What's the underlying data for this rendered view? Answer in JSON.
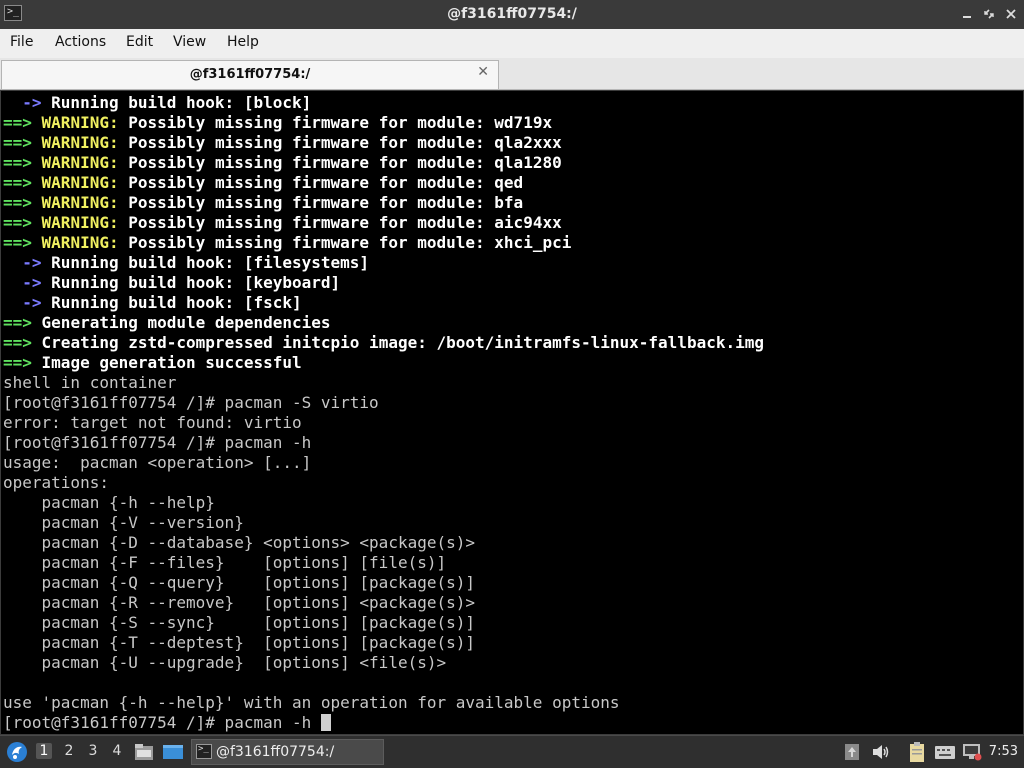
{
  "window": {
    "title": "@f3161ff07754:/",
    "icon": "terminal-icon"
  },
  "menubar": {
    "items": [
      "File",
      "Actions",
      "Edit",
      "View",
      "Help"
    ]
  },
  "tab": {
    "label": "@f3161ff07754:/"
  },
  "terminal": {
    "lines": [
      [
        {
          "t": "  ",
          "c": ""
        },
        {
          "t": "->",
          "c": "bl"
        },
        {
          "t": " Running build hook: [block]",
          "c": "b"
        }
      ],
      [
        {
          "t": "==>",
          "c": "g"
        },
        {
          "t": " WARNING:",
          "c": "y"
        },
        {
          "t": " Possibly missing firmware for module: wd719x",
          "c": "b"
        }
      ],
      [
        {
          "t": "==>",
          "c": "g"
        },
        {
          "t": " WARNING:",
          "c": "y"
        },
        {
          "t": " Possibly missing firmware for module: qla2xxx",
          "c": "b"
        }
      ],
      [
        {
          "t": "==>",
          "c": "g"
        },
        {
          "t": " WARNING:",
          "c": "y"
        },
        {
          "t": " Possibly missing firmware for module: qla1280",
          "c": "b"
        }
      ],
      [
        {
          "t": "==>",
          "c": "g"
        },
        {
          "t": " WARNING:",
          "c": "y"
        },
        {
          "t": " Possibly missing firmware for module: qed",
          "c": "b"
        }
      ],
      [
        {
          "t": "==>",
          "c": "g"
        },
        {
          "t": " WARNING:",
          "c": "y"
        },
        {
          "t": " Possibly missing firmware for module: bfa",
          "c": "b"
        }
      ],
      [
        {
          "t": "==>",
          "c": "g"
        },
        {
          "t": " WARNING:",
          "c": "y"
        },
        {
          "t": " Possibly missing firmware for module: aic94xx",
          "c": "b"
        }
      ],
      [
        {
          "t": "==>",
          "c": "g"
        },
        {
          "t": " WARNING:",
          "c": "y"
        },
        {
          "t": " Possibly missing firmware for module: xhci_pci",
          "c": "b"
        }
      ],
      [
        {
          "t": "  ",
          "c": ""
        },
        {
          "t": "->",
          "c": "bl"
        },
        {
          "t": " Running build hook: [filesystems]",
          "c": "b"
        }
      ],
      [
        {
          "t": "  ",
          "c": ""
        },
        {
          "t": "->",
          "c": "bl"
        },
        {
          "t": " Running build hook: [keyboard]",
          "c": "b"
        }
      ],
      [
        {
          "t": "  ",
          "c": ""
        },
        {
          "t": "->",
          "c": "bl"
        },
        {
          "t": " Running build hook: [fsck]",
          "c": "b"
        }
      ],
      [
        {
          "t": "==>",
          "c": "g"
        },
        {
          "t": " Generating module dependencies",
          "c": "b"
        }
      ],
      [
        {
          "t": "==>",
          "c": "g"
        },
        {
          "t": " Creating zstd-compressed initcpio image: /boot/initramfs-linux-fallback.img",
          "c": "b"
        }
      ],
      [
        {
          "t": "==>",
          "c": "g"
        },
        {
          "t": " Image generation successful",
          "c": "b"
        }
      ],
      [
        {
          "t": "shell in container",
          "c": ""
        }
      ],
      [
        {
          "t": "[root@f3161ff07754 /]# pacman -S virtio",
          "c": ""
        }
      ],
      [
        {
          "t": "error: target not found: virtio",
          "c": ""
        }
      ],
      [
        {
          "t": "[root@f3161ff07754 /]# pacman -h",
          "c": ""
        }
      ],
      [
        {
          "t": "usage:  pacman <operation> [...]",
          "c": ""
        }
      ],
      [
        {
          "t": "operations:",
          "c": ""
        }
      ],
      [
        {
          "t": "    pacman {-h --help}",
          "c": ""
        }
      ],
      [
        {
          "t": "    pacman {-V --version}",
          "c": ""
        }
      ],
      [
        {
          "t": "    pacman {-D --database} <options> <package(s)>",
          "c": ""
        }
      ],
      [
        {
          "t": "    pacman {-F --files}    [options] [file(s)]",
          "c": ""
        }
      ],
      [
        {
          "t": "    pacman {-Q --query}    [options] [package(s)]",
          "c": ""
        }
      ],
      [
        {
          "t": "    pacman {-R --remove}   [options] <package(s)>",
          "c": ""
        }
      ],
      [
        {
          "t": "    pacman {-S --sync}     [options] [package(s)]",
          "c": ""
        }
      ],
      [
        {
          "t": "    pacman {-T --deptest}  [options] [package(s)]",
          "c": ""
        }
      ],
      [
        {
          "t": "    pacman {-U --upgrade}  [options] <file(s)>",
          "c": ""
        }
      ],
      [
        {
          "t": "",
          "c": ""
        }
      ],
      [
        {
          "t": "use 'pacman {-h --help}' with an operation for available options",
          "c": ""
        }
      ],
      [
        {
          "t": "[root@f3161ff07754 /]# pacman -h ",
          "c": ""
        }
      ]
    ]
  },
  "taskbar": {
    "workspaces": [
      "1",
      "2",
      "3",
      "4"
    ],
    "active_workspace": "1",
    "task_label": "@f3161ff07754:/",
    "clock": "7:53",
    "tray_icons": [
      "upload-icon",
      "volume-icon",
      "clipboard-icon",
      "keyboard-icon",
      "network-icon"
    ]
  },
  "colors": {
    "prompt_arrow_green": "#5fe05f",
    "warning_yellow": "#f0f060",
    "hook_arrow_blue": "#7a7aff",
    "terminal_bg": "#000000",
    "titlebar_bg": "#3a3a3a",
    "taskbar_bg": "#2f2f2f"
  }
}
